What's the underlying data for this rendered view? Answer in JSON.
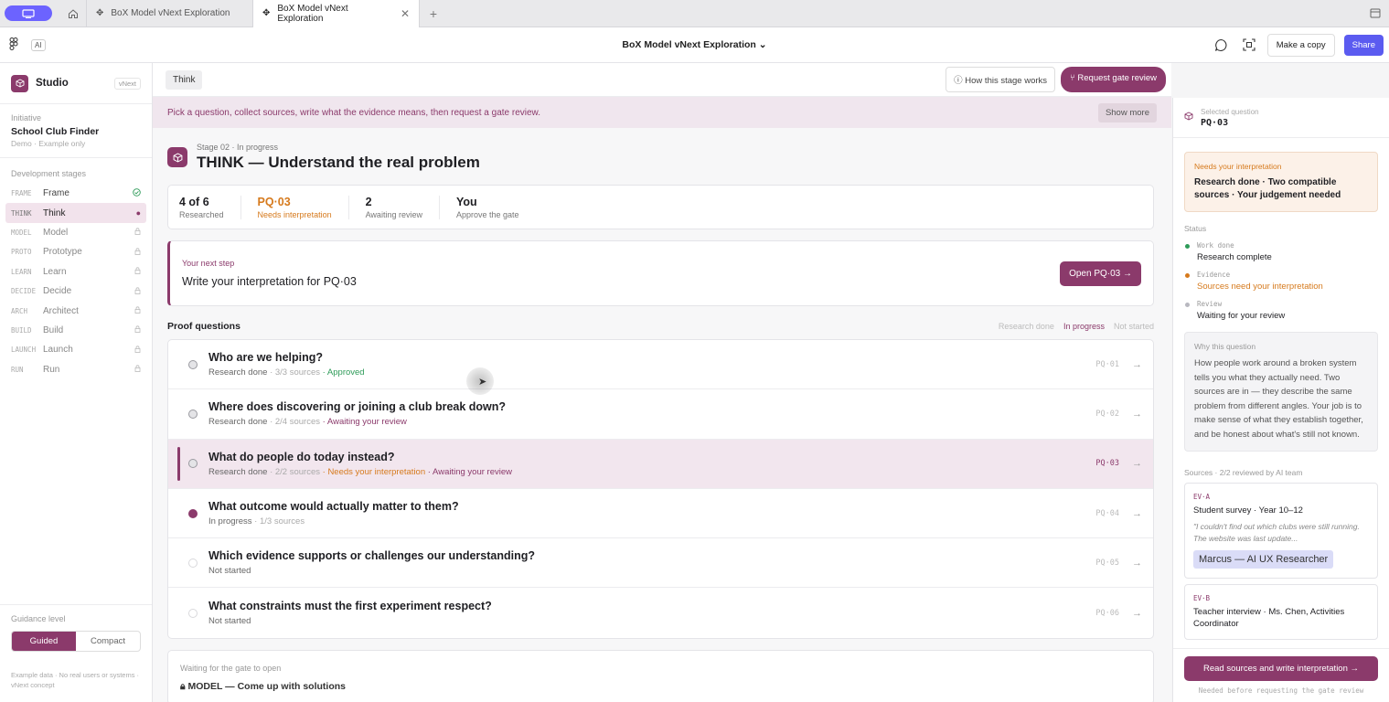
{
  "browser": {
    "tabs": [
      {
        "label": "BoX Model vNext Exploration",
        "active": false
      },
      {
        "label": "BoX Model vNext Exploration",
        "active": true
      }
    ],
    "new_tab": "+",
    "close": "✕"
  },
  "header": {
    "ai_badge": "AI",
    "doc_title": "BoX Model vNext Exploration",
    "make_copy": "Make a copy",
    "share": "Share"
  },
  "sidebar": {
    "brand": "Studio",
    "version": "vNext",
    "initiative_label": "Initiative",
    "initiative_name": "School Club Finder",
    "demo_note": "Demo · Example only",
    "stages_label": "Development stages",
    "stages": [
      {
        "code": "FRAME",
        "name": "Frame",
        "state": "done"
      },
      {
        "code": "THINK",
        "name": "Think",
        "state": "active"
      },
      {
        "code": "MODEL",
        "name": "Model",
        "state": "locked"
      },
      {
        "code": "PROTO",
        "name": "Prototype",
        "state": "locked"
      },
      {
        "code": "LEARN",
        "name": "Learn",
        "state": "locked"
      },
      {
        "code": "DECIDE",
        "name": "Decide",
        "state": "locked"
      },
      {
        "code": "ARCH",
        "name": "Architect",
        "state": "locked"
      },
      {
        "code": "BUILD",
        "name": "Build",
        "state": "locked"
      },
      {
        "code": "LAUNCH",
        "name": "Launch",
        "state": "locked"
      },
      {
        "code": "RUN",
        "name": "Run",
        "state": "locked"
      }
    ],
    "guidance_label": "Guidance level",
    "guidance_options": [
      "Guided",
      "Compact"
    ],
    "footer_note": "Example data · No real users or systems · vNext concept"
  },
  "main": {
    "breadcrumb": "Think",
    "how_button": "How this stage works",
    "gate_button": "Request gate review",
    "banner": "Pick a question, collect sources, write what the evidence means, then request a gate review.",
    "show_more": "Show more",
    "stage_sub": "Stage 02 · In progress",
    "stage_title": "THINK — Understand the real problem",
    "stats": [
      {
        "value": "4 of 6",
        "label": "Researched"
      },
      {
        "value": "PQ·03",
        "label": "Needs interpretation"
      },
      {
        "value": "2",
        "label": "Awaiting review"
      },
      {
        "value": "You",
        "label": "Approve the gate"
      }
    ],
    "next_step_label": "Your next step",
    "next_step_text": "Write your interpretation for PQ·03",
    "open_button": "Open PQ·03 →",
    "pq_title": "Proof questions",
    "legend": [
      "Research done",
      "In progress",
      "Not started"
    ],
    "questions": [
      {
        "q": "Who are we helping?",
        "status": "Research done",
        "sources": "· 3/3 sources",
        "tag1": "· Approved",
        "tag2": "",
        "id": "PQ·01"
      },
      {
        "q": "Where does discovering or joining a club break down?",
        "status": "Research done",
        "sources": "· 2/4 sources",
        "tag1": "· Awaiting your review",
        "tag2": "",
        "id": "PQ·02"
      },
      {
        "q": "What do people do today instead?",
        "status": "Research done",
        "sources": "· 2/2 sources",
        "tag1": "· Needs your interpretation",
        "tag2": "· Awaiting your review",
        "id": "PQ·03"
      },
      {
        "q": "What outcome would actually matter to them?",
        "status": "In progress",
        "sources": "· 1/3 sources",
        "tag1": "",
        "tag2": "",
        "id": "PQ·04"
      },
      {
        "q": "Which evidence supports or challenges our understanding?",
        "status": "Not started",
        "sources": "",
        "tag1": "",
        "tag2": "",
        "id": "PQ·05"
      },
      {
        "q": "What constraints must the first experiment respect?",
        "status": "Not started",
        "sources": "",
        "tag1": "",
        "tag2": "",
        "id": "PQ·06"
      }
    ],
    "waiting_label": "Waiting for the gate to open",
    "waiting_text": "MODEL — Come up with solutions"
  },
  "panel": {
    "selected_label": "Selected question",
    "selected_value": "PQ·03",
    "need_label": "Needs your interpretation",
    "need_text": "Research done · Two compatible sources · Your judgement needed",
    "status_label": "Status",
    "status": [
      {
        "key": "Work done",
        "value": "Research complete",
        "color": "#2e9b59"
      },
      {
        "key": "Evidence",
        "value": "Sources need your interpretation",
        "color": "#d67a1d"
      },
      {
        "key": "Review",
        "value": "Waiting for your review",
        "color": "#b8b8c0"
      }
    ],
    "why_label": "Why this question",
    "why_text": "How people work around a broken system tells you what they actually need. Two sources are in — they describe the same problem from different angles. Your job is to make sense of what they establish together, and be honest about what's still not known.",
    "sources_label": "Sources · 2/2 reviewed by AI team",
    "sources": [
      {
        "code": "EV·A",
        "name": "Student survey · Year 10–12",
        "quote": "\"I couldn't find out which clubs were still running. The website was last update...",
        "chip": "Marcus — AI UX Researcher"
      },
      {
        "code": "EV·B",
        "name": "Teacher interview · Ms. Chen, Activities Coordinator",
        "quote": "",
        "chip": ""
      }
    ],
    "read_button": "Read sources and write interpretation →",
    "read_note": "Needed before requesting the gate review"
  },
  "colors": {
    "accent": "#8b3a6b",
    "share": "#5b5bf0",
    "warn": "#d67a1d",
    "ok": "#2e9b59"
  }
}
